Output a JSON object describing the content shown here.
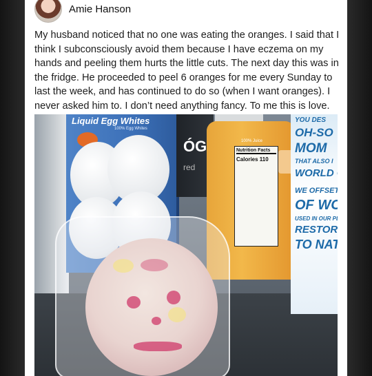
{
  "post": {
    "author_name": "Amie Hanson",
    "text": "My husband noticed that no one was eating the oranges. I said that I think I subconsciously avoid them because I have eczema on my hands and peeling them hurts the little cuts. The next day this was in the fridge. He proceeded to peel 6 oranges for me every Sunday to last the week, and has continued to do so (when I want oranges). I never asked him to. I don’t need anything fancy. To me this is love."
  },
  "photo": {
    "egg_carton_title": "Liquid Egg Whites",
    "egg_carton_sub": "100% Egg Whites",
    "dark_box_text": "ÓG",
    "dark_box_sub": "red",
    "juice_label": "100% Juice",
    "nutrition_title": "Nutrition Facts",
    "nutrition_calories": "Calories 110",
    "milk_lines": [
      "YOU DES",
      "OH-SO",
      "MOM",
      "THAT ALSO I",
      "WORLD G",
      "WE OFFSET",
      "OF WO",
      "USED IN OUR PL",
      "RESTORING",
      "TO NATU"
    ]
  },
  "colors": {
    "card_background": "#ffffff",
    "frame_background": "#1f1f1f",
    "text": "#1c1c1c",
    "carton_blue": "#3c70b8",
    "juice_orange": "#f2b84a",
    "milk_blue": "#1d6aa8"
  }
}
